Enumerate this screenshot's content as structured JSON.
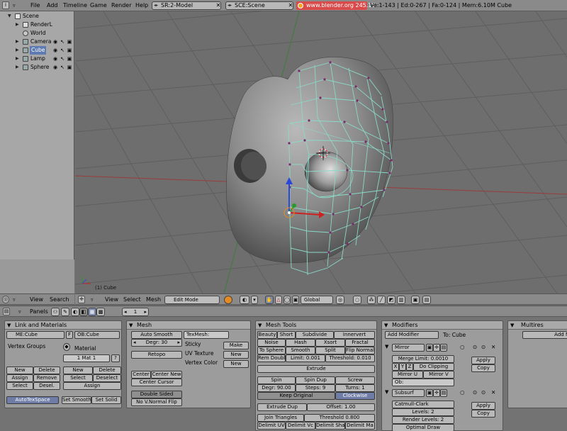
{
  "menu": [
    "File",
    "Add",
    "Timeline",
    "Game",
    "Render",
    "Help"
  ],
  "screen_field": "SR:2-Model",
  "scene_field": "SCE:Scene",
  "url_badge": "www.blender.org 245.15",
  "stats": "Ve:1-143 | Ed:0-267 | Fa:0-124 | Mem:6.10M Cube",
  "outliner": {
    "items": [
      {
        "label": "Scene"
      },
      {
        "label": "RenderL"
      },
      {
        "label": "World"
      },
      {
        "label": "Camera"
      },
      {
        "label": "Cube"
      },
      {
        "label": "Lamp"
      },
      {
        "label": "Sphere"
      }
    ]
  },
  "outliner_header": {
    "view": "View",
    "search": "Search"
  },
  "viewport": {
    "object_label": "(1) Cube"
  },
  "view3d_header": {
    "view": "View",
    "select": "Select",
    "mesh": "Mesh",
    "mode": "Edit Mode",
    "orientation": "Global"
  },
  "buttons_header": {
    "panels": "Panels",
    "frame": "1"
  },
  "panels": {
    "link": {
      "title": "Link and Materials",
      "me": "ME:Cube",
      "f": "F",
      "ob": "OB:Cube",
      "vertex_groups": "Vertex Groups",
      "material": "Material",
      "mat_field": "1 Mat 1",
      "q": "?",
      "vg_buttons": [
        "New",
        "Delete",
        "Assign",
        "Remove",
        "Select",
        "Desel."
      ],
      "mat_buttons": [
        "New",
        "Delete",
        "Select",
        "Deselect",
        "Assign"
      ],
      "autotexspace": "AutoTexSpace",
      "set_smooth": "Set Smooth",
      "set_solid": "Set Solid"
    },
    "mesh": {
      "title": "Mesh",
      "auto_smooth": "Auto Smooth",
      "degr": "Degr: 30",
      "retopo": "Retopo",
      "texmesh": "TexMesh:",
      "sticky": "Sticky",
      "make": "Make",
      "uv_texture": "UV Texture",
      "new1": "New",
      "vertex_color": "Vertex Color",
      "new2": "New",
      "center": "Center",
      "center_new": "Center New",
      "center_cursor": "Center Cursor",
      "double_sided": "Double Sided",
      "no_vnormal_flip": "No V.Normal Flip"
    },
    "tools": {
      "title": "Mesh Tools",
      "row1": [
        "Beauty",
        "Short",
        "Subdivide",
        "Innervert"
      ],
      "row2": [
        "Noise",
        "Hash",
        "Xsort",
        "Fractal"
      ],
      "row3": [
        "To Sphere",
        "Smooth",
        "Split",
        "Flip Normal"
      ],
      "row4": [
        "Rem Doubl",
        "Limit: 0.001",
        "Threshold: 0.010"
      ],
      "extrude": "Extrude",
      "spin_row": [
        "Spin",
        "Spin Dup",
        "Screw"
      ],
      "degr_row": [
        "Degr: 90.00",
        "Steps: 9",
        "Turns: 1"
      ],
      "keep_original": "Keep Original",
      "clockwise": "Clockwise",
      "extrude_dup": "Extrude Dup",
      "offset": "Offset: 1.00",
      "join_triangles": "Join Triangles",
      "threshold": "Threshold 0.800",
      "delimit": [
        "Delimit UV",
        "Delimit Vc",
        "Delimit Sha",
        "Delimit Ma"
      ]
    },
    "modifiers": {
      "title": "Modifiers",
      "add_modifier": "Add Modifier",
      "to": "To: Cube",
      "mirror": {
        "name": "Mirror",
        "merge_limit": "Merge Limit: 0.0010",
        "axes": [
          "X",
          "Y",
          "Z"
        ],
        "do_clipping": "Do Clipping",
        "mirror_u": "Mirror U",
        "mirror_v": "Mirror V",
        "ob": "Ob:",
        "apply": "Apply",
        "copy": "Copy"
      },
      "subsurf": {
        "name": "Subsurf",
        "type": "Catmull-Clark",
        "levels": "Levels: 2",
        "render_levels": "Render Levels: 2",
        "optimal_draw": "Optimal Draw",
        "apply": "Apply",
        "copy": "Copy"
      }
    },
    "multires": {
      "title": "Multires",
      "add": "Add M"
    }
  },
  "colors": {
    "viewport_bg": "#6e6e6e",
    "grid_line": "#5f5f5f",
    "x_axis": "#9a3b3b",
    "y_axis": "#3c7d3c",
    "wire": "#8ad9c6",
    "vertex": "#7a2a6a",
    "url_badge": "#d94a4a"
  }
}
